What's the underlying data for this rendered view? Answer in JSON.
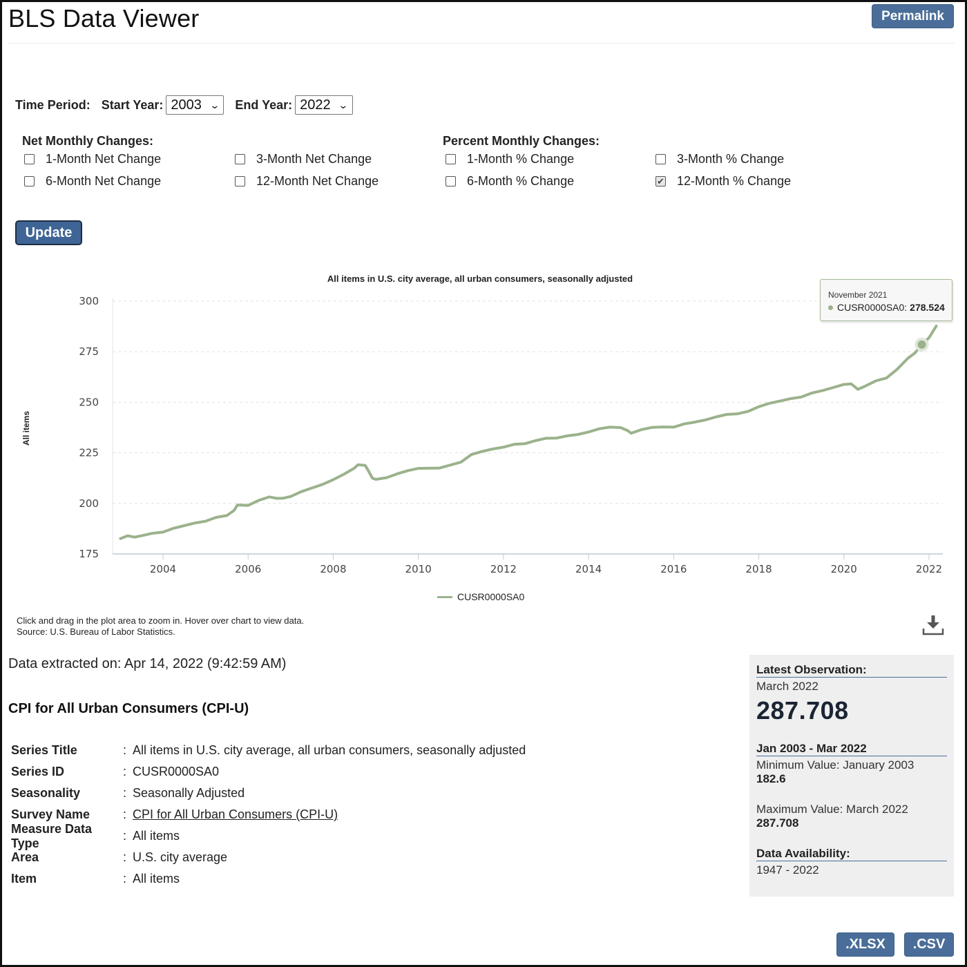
{
  "header": {
    "app_title": "BLS Data Viewer",
    "permalink_label": "Permalink"
  },
  "time_period": {
    "label": "Time Period:",
    "start_label": "Start Year:",
    "start_value": "2003",
    "end_label": "End Year:",
    "end_value": "2022"
  },
  "net_changes": {
    "title": "Net Monthly Changes:",
    "items": [
      {
        "label": "1-Month Net Change",
        "checked": false
      },
      {
        "label": "3-Month Net Change",
        "checked": false
      },
      {
        "label": "6-Month Net Change",
        "checked": false
      },
      {
        "label": "12-Month Net Change",
        "checked": false
      }
    ]
  },
  "percent_changes": {
    "title": "Percent Monthly Changes:",
    "items": [
      {
        "label": "1-Month % Change",
        "checked": false
      },
      {
        "label": "3-Month % Change",
        "checked": false
      },
      {
        "label": "6-Month % Change",
        "checked": false
      },
      {
        "label": "12-Month % Change",
        "checked": true
      }
    ]
  },
  "update_label": "Update",
  "chart": {
    "title": "All items in U.S. city average, all urban consumers, seasonally adjusted",
    "tooltip_date": "November 2021",
    "tooltip_series": "CUSR0000SA0:",
    "tooltip_value": "278.524",
    "legend_label": "CUSR0000SA0",
    "note_line1": "Click and drag in the plot area to zoom in. Hover over chart to view data.",
    "note_line2": "Source: U.S. Bureau of Labor Statistics."
  },
  "chart_data": {
    "type": "line",
    "title": "All items in U.S. city average, all urban consumers, seasonally adjusted",
    "xlabel": "",
    "ylabel": "All items",
    "x_ticks": [
      "2004",
      "2006",
      "2008",
      "2010",
      "2012",
      "2014",
      "2016",
      "2018",
      "2020",
      "2022"
    ],
    "y_ticks": [
      "175",
      "200",
      "225",
      "250",
      "275",
      "300"
    ],
    "ylim": [
      175,
      300
    ],
    "xlim": [
      2003.0,
      2022.25
    ],
    "grid": "horizontal dashed",
    "legend": "bottom-center",
    "series": [
      {
        "name": "CUSR0000SA0",
        "color": "#9bb28c",
        "x": [
          2003.0,
          2003.17,
          2003.33,
          2003.5,
          2003.75,
          2004.0,
          2004.25,
          2004.5,
          2004.75,
          2005.0,
          2005.25,
          2005.5,
          2005.67,
          2005.75,
          2006.0,
          2006.25,
          2006.5,
          2006.67,
          2006.83,
          2007.0,
          2007.25,
          2007.5,
          2007.75,
          2008.0,
          2008.25,
          2008.5,
          2008.58,
          2008.75,
          2008.83,
          2008.92,
          2009.0,
          2009.25,
          2009.5,
          2009.75,
          2010.0,
          2010.5,
          2011.0,
          2011.25,
          2011.5,
          2011.75,
          2012.0,
          2012.25,
          2012.5,
          2012.75,
          2013.0,
          2013.25,
          2013.5,
          2013.75,
          2014.0,
          2014.25,
          2014.5,
          2014.75,
          2014.92,
          2015.0,
          2015.25,
          2015.5,
          2015.75,
          2016.0,
          2016.25,
          2016.5,
          2016.75,
          2017.0,
          2017.25,
          2017.5,
          2017.75,
          2018.0,
          2018.25,
          2018.5,
          2018.75,
          2019.0,
          2019.25,
          2019.5,
          2019.75,
          2020.0,
          2020.17,
          2020.33,
          2020.5,
          2020.75,
          2021.0,
          2021.25,
          2021.5,
          2021.67,
          2021.83,
          2022.0,
          2022.17
        ],
        "values": [
          182.6,
          184.0,
          183.3,
          184.0,
          185.2,
          185.8,
          187.7,
          189.0,
          190.3,
          191.2,
          193.1,
          194.0,
          196.5,
          199.2,
          199.0,
          201.5,
          203.2,
          202.5,
          202.6,
          203.4,
          205.8,
          207.6,
          209.4,
          211.7,
          214.4,
          217.5,
          219.1,
          218.8,
          216.0,
          212.5,
          211.9,
          212.7,
          214.6,
          216.2,
          217.3,
          217.5,
          220.4,
          224.2,
          225.7,
          226.9,
          227.8,
          229.2,
          229.5,
          231.0,
          232.2,
          232.3,
          233.4,
          234.1,
          235.3,
          236.9,
          237.7,
          237.5,
          236.0,
          234.7,
          236.5,
          237.6,
          237.8,
          237.7,
          239.3,
          240.2,
          241.3,
          242.8,
          244.0,
          244.3,
          245.5,
          247.8,
          249.5,
          250.6,
          251.8,
          252.6,
          254.6,
          255.8,
          257.3,
          258.8,
          259.1,
          256.4,
          258.0,
          260.6,
          262.0,
          266.3,
          271.7,
          274.4,
          278.524,
          281.9,
          287.708
        ]
      }
    ]
  },
  "extracted_text": "Data extracted on: Apr 14, 2022 (9:42:59 AM)",
  "survey_title": "CPI for All Urban Consumers (CPI-U)",
  "series_meta": [
    {
      "key": "Series Title",
      "value": "All items in U.S. city average, all urban consumers, seasonally adjusted",
      "link": false
    },
    {
      "key": "Series ID",
      "value": "CUSR0000SA0",
      "link": false
    },
    {
      "key": "Seasonality",
      "value": "Seasonally Adjusted",
      "link": false
    },
    {
      "key": "Survey Name",
      "value": "CPI for All Urban Consumers (CPI-U)",
      "link": true
    },
    {
      "key": "Measure Data Type",
      "value": "All items",
      "link": false
    },
    {
      "key": "Area",
      "value": "U.S. city average",
      "link": false
    },
    {
      "key": "Item",
      "value": "All items",
      "link": false
    }
  ],
  "stats": {
    "latest_label": "Latest Observation:",
    "latest_period": "March 2022",
    "latest_value": "287.708",
    "range_label": "Jan 2003 - Mar 2022",
    "min_label": "Minimum Value: January 2003",
    "min_value": "182.6",
    "max_label": "Maximum Value: March 2022",
    "max_value": "287.708",
    "availability_label": "Data Availability:",
    "availability_value": "1947 - 2022"
  },
  "export": {
    "xlsx_label": ".XLSX",
    "csv_label": ".CSV"
  },
  "colors": {
    "accent": "#4a6e99",
    "series": "#9bb28c",
    "panel_bg": "#efefef"
  }
}
